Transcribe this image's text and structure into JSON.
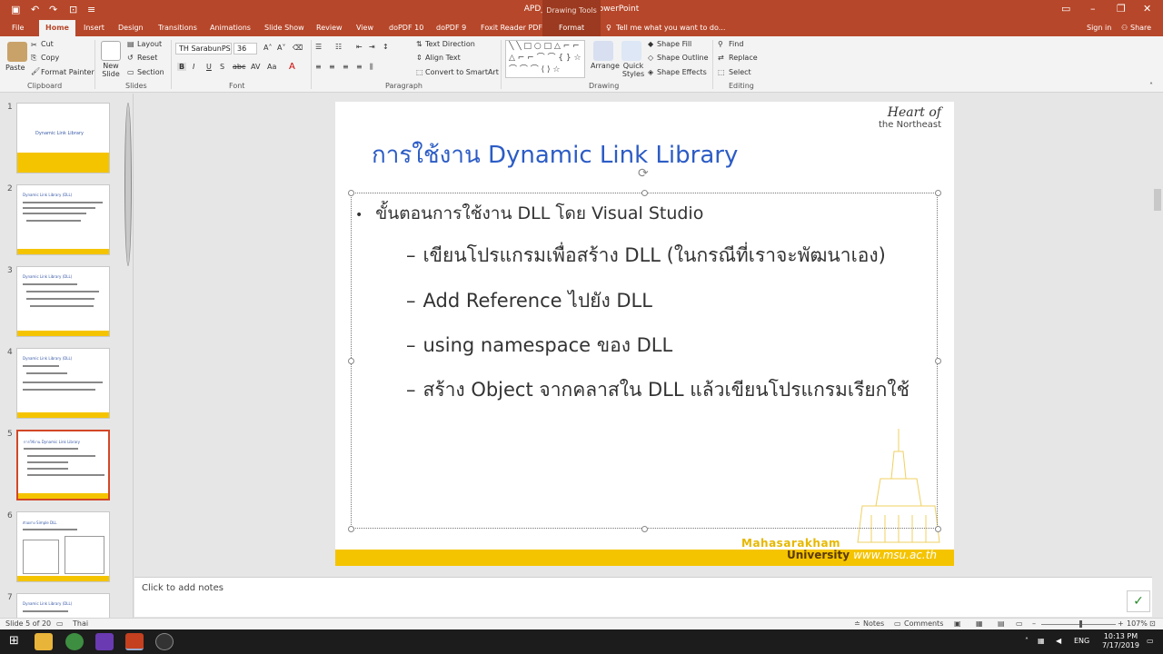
{
  "window": {
    "title": "APD_CH6_1_62 - PowerPoint",
    "context_label": "Drawing Tools",
    "sign_in": "Sign in",
    "share": "Share"
  },
  "tabs": [
    "File",
    "Home",
    "Insert",
    "Design",
    "Transitions",
    "Animations",
    "Slide Show",
    "Review",
    "View",
    "doPDF 10",
    "doPDF 9",
    "Foxit Reader PDF",
    "Format"
  ],
  "tell_me": "Tell me what you want to do...",
  "ribbon": {
    "clipboard": {
      "paste": "Paste",
      "cut": "Cut",
      "copy": "Copy",
      "format_painter": "Format Painter",
      "label": "Clipboard"
    },
    "slides": {
      "new_slide": "New Slide",
      "layout": "Layout",
      "reset": "Reset",
      "section": "Section",
      "label": "Slides"
    },
    "font": {
      "name": "TH SarabunPSK",
      "size": "36",
      "label": "Font"
    },
    "paragraph": {
      "text_direction": "Text Direction",
      "align_text": "Align Text",
      "convert": "Convert to SmartArt",
      "label": "Paragraph"
    },
    "drawing": {
      "arrange": "Arrange",
      "quick_styles": "Quick Styles",
      "shape_fill": "Shape Fill",
      "shape_outline": "Shape Outline",
      "shape_effects": "Shape Effects",
      "label": "Drawing"
    },
    "editing": {
      "find": "Find",
      "replace": "Replace",
      "select": "Select",
      "label": "Editing"
    }
  },
  "thumbnails": [
    {
      "num": "1",
      "title": "Dynamic Link Library"
    },
    {
      "num": "2",
      "title": "Dynamic Link Library (DLL)"
    },
    {
      "num": "3",
      "title": "Dynamic Link Library (DLL)"
    },
    {
      "num": "4",
      "title": "Dynamic Link Library (DLL)"
    },
    {
      "num": "5",
      "title": "การใช้งาน Dynamic Link Library"
    },
    {
      "num": "6",
      "title": "ตัวอย่าง Simple DLL"
    },
    {
      "num": "7",
      "title": "Dynamic Link Library (DLL)"
    }
  ],
  "slide": {
    "heart_line1": "Heart of",
    "heart_line2": "the Northeast",
    "title": "การใช้งาน Dynamic Link Library",
    "bullet": "ขั้นตอนการใช้งาน DLL โดย Visual Studio",
    "subbullets": [
      "เขียนโปรแกรมเพื่อสร้าง DLL (ในกรณีที่เราจะพัฒนาเอง)",
      "Add Reference ไปยัง DLL",
      "using namespace ของ DLL",
      "สร้าง Object  จากคลาสใน DLL แล้วเขียนโปรแกรมเรียกใช้"
    ],
    "logo_line1": "Mahasarakham",
    "logo_line2": "University",
    "logo_url": "www.msu.ac.th"
  },
  "notes_placeholder": "Click to add notes",
  "status": {
    "slide_of": "Slide 5 of 20",
    "language": "Thai",
    "notes": "Notes",
    "comments": "Comments",
    "zoom": "107%"
  },
  "taskbar": {
    "lang": "ENG",
    "time": "10:13 PM",
    "date": "7/17/2019"
  }
}
